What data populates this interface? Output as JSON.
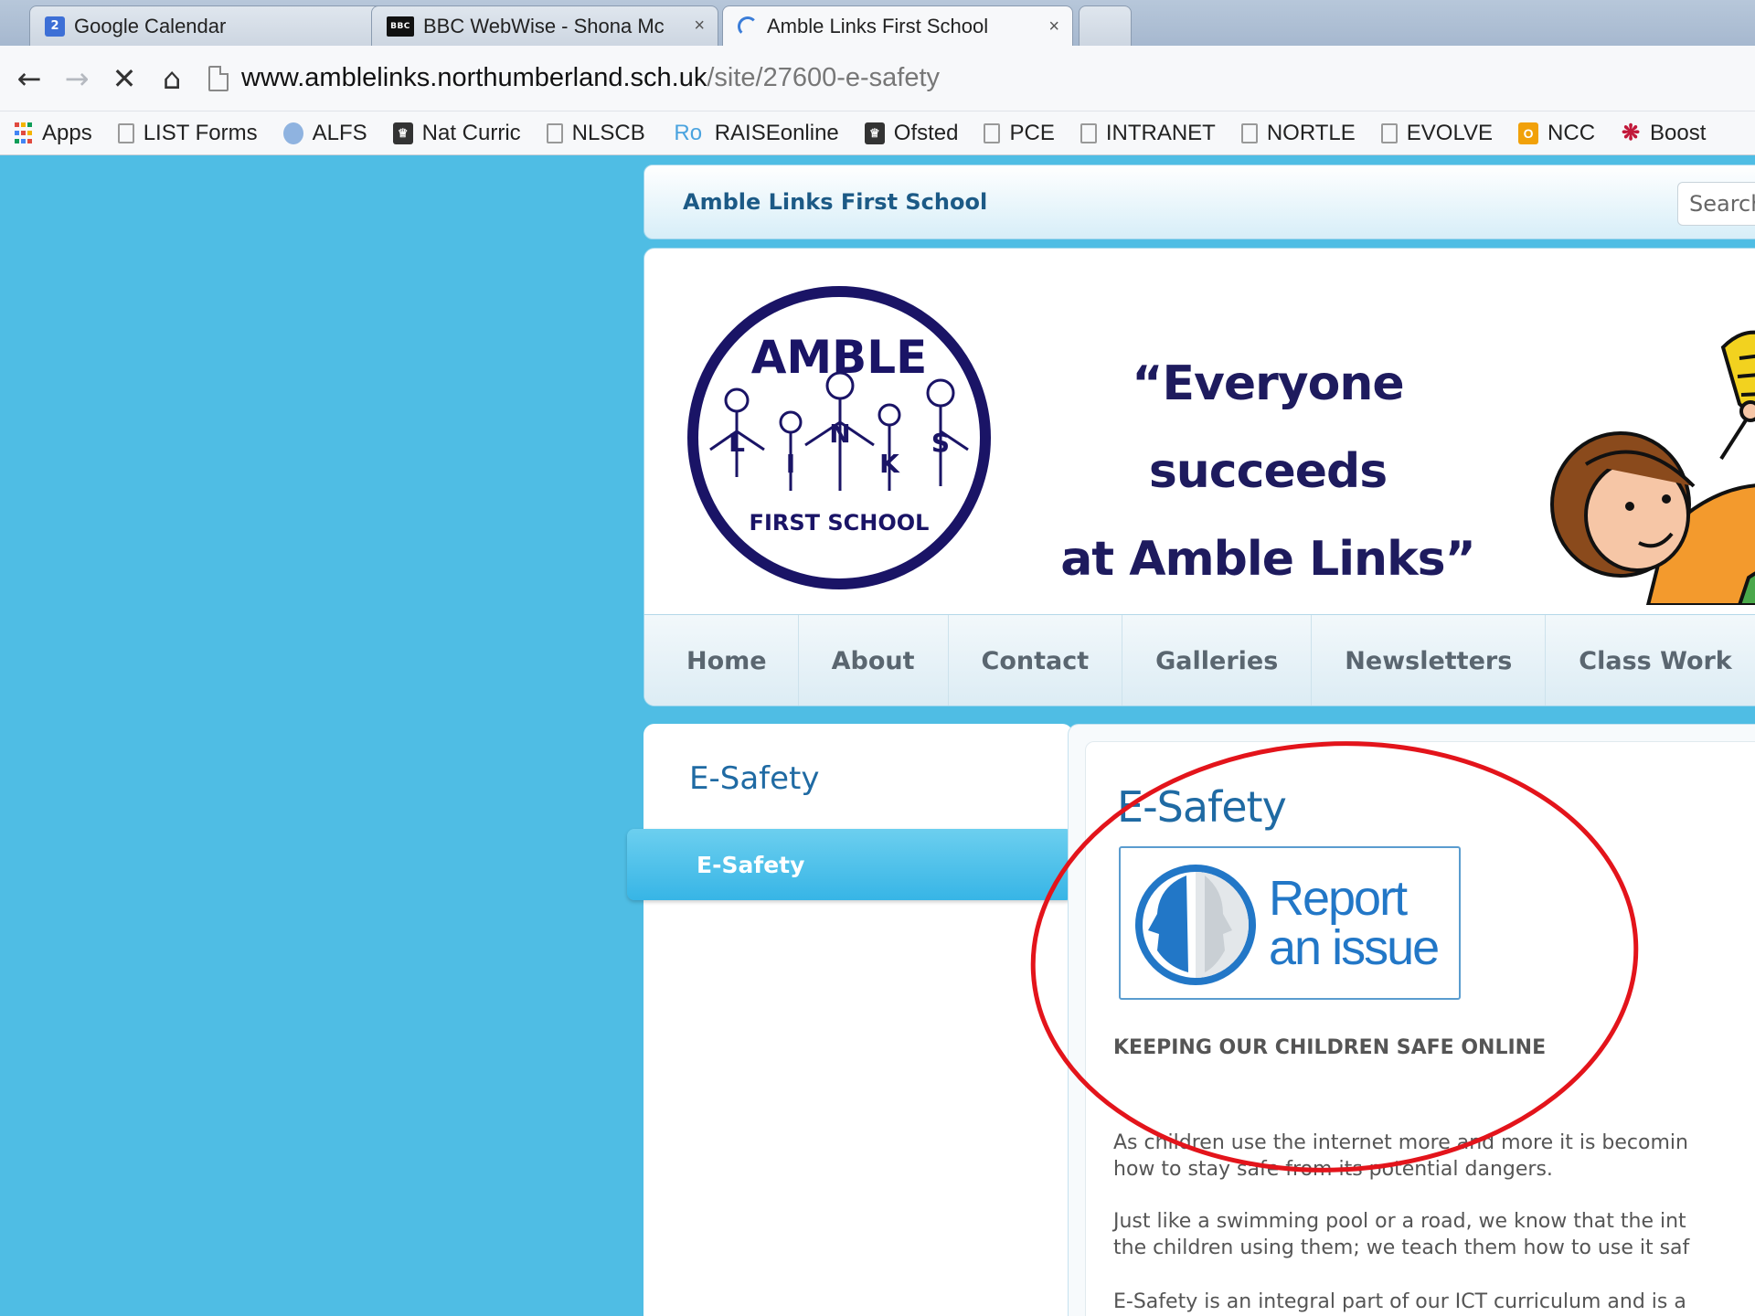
{
  "browser": {
    "tabs": [
      {
        "title": "Google Calendar",
        "favicon": "calendar-icon",
        "favicon_text": "2"
      },
      {
        "title": "BBC WebWise - Shona Mc",
        "favicon": "bbc-icon",
        "favicon_text": "BBC"
      },
      {
        "title": "Amble Links First School",
        "favicon": "loading-spinner-icon",
        "active": true
      }
    ],
    "tab_close_glyph": "×",
    "url_host": "www.amblelinks.northumberland.sch.uk",
    "url_path": "/site/27600-e-safety",
    "bookmarks": [
      {
        "label": "Apps",
        "icon": "apps-grid-icon"
      },
      {
        "label": "LIST Forms",
        "icon": "page-icon"
      },
      {
        "label": "ALFS",
        "icon": "people-icon"
      },
      {
        "label": "Nat Curric",
        "icon": "crown-icon"
      },
      {
        "label": "NLSCB",
        "icon": "page-icon"
      },
      {
        "label": "RAISEonline",
        "icon": "ro-icon",
        "icon_text": "Ro"
      },
      {
        "label": "Ofsted",
        "icon": "crown-icon"
      },
      {
        "label": "PCE",
        "icon": "page-icon"
      },
      {
        "label": "INTRANET",
        "icon": "page-icon"
      },
      {
        "label": "NORTLE",
        "icon": "page-icon"
      },
      {
        "label": "EVOLVE",
        "icon": "page-icon"
      },
      {
        "label": "NCC",
        "icon": "outlook-icon",
        "icon_text": "O"
      },
      {
        "label": "Boost",
        "icon": "boost-icon"
      }
    ]
  },
  "site": {
    "name": "Amble Links First School",
    "search_placeholder": "Search",
    "logo": {
      "top": "AMBLE",
      "letters": [
        "L",
        "I",
        "N",
        "K",
        "S"
      ],
      "bottom": "FIRST SCHOOL"
    },
    "motto_line1": "“Everyone succeeds",
    "motto_line2": "at Amble Links”",
    "nav": [
      "Home",
      "About",
      "Contact",
      "Galleries",
      "Newsletters",
      "Class Work"
    ],
    "sidebar_title": "E-Safety",
    "sidebar_items": [
      "E-Safety"
    ],
    "page_title": "E-Safety",
    "report_badge": {
      "line1": "Report",
      "line2": "an issue"
    },
    "section_heading": "KEEPING OUR CHILDREN SAFE ONLINE",
    "paragraphs": [
      "As children use the internet more and more it is becomin\nhow to stay safe from its potential dangers.",
      "Just like a swimming pool or a road, we know that the int\nthe children using them; we teach them how to use it saf",
      "E-Safety is an integral part of our ICT curriculum and is a"
    ]
  },
  "colors": {
    "page_background": "#4fbde4",
    "accent_blue": "#1f6aa3",
    "annotation_red": "#e3141b"
  }
}
